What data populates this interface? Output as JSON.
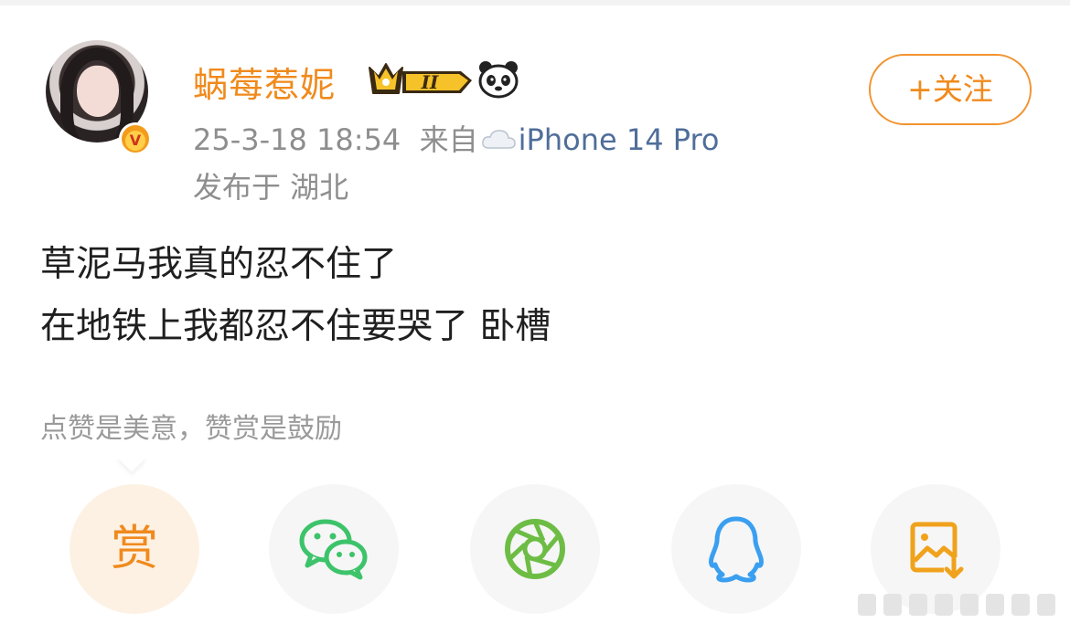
{
  "user": {
    "name": "蜗莓惹妮",
    "crown_level": "II",
    "avatar_badge": "V"
  },
  "meta": {
    "time": "25-3-18 18:54",
    "from_label": "来自",
    "source": "iPhone 14 Pro",
    "location": "发布于 湖北"
  },
  "follow_button": "+关注",
  "post": {
    "lines": [
      "草泥马我真的忍不住了",
      "在地铁上我都忍不住要哭了 卧槽"
    ]
  },
  "reward_tip": "点赞是美意，赞赏是鼓励",
  "share": {
    "reward_label": "赏",
    "icons": [
      "reward-icon",
      "wechat-icon",
      "moments-icon",
      "qq-icon",
      "save-image-icon"
    ]
  },
  "colors": {
    "accent": "#f08a1c",
    "link": "#4f6e9a",
    "gray_text": "#8e8e8e",
    "wechat": "#3dc36a",
    "moments": "#6dbd45",
    "qq": "#3a9ff0"
  }
}
